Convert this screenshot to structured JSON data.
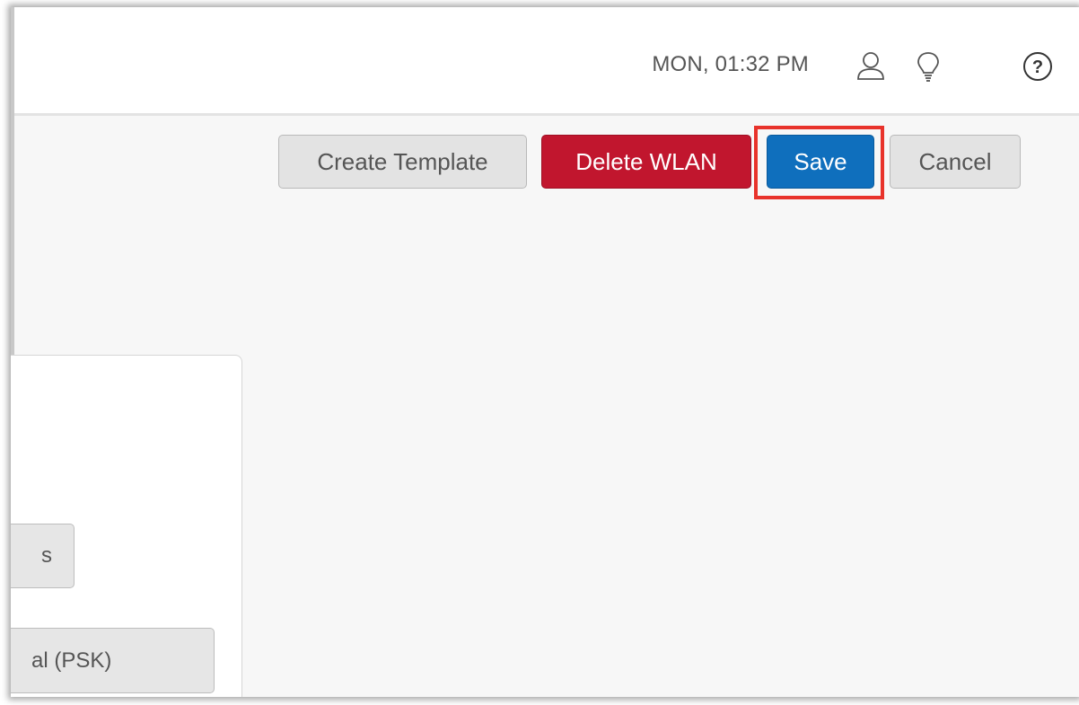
{
  "header": {
    "clock": "MON, 01:32 PM",
    "icons": [
      "user-icon",
      "lightbulb-icon",
      "help-icon"
    ]
  },
  "toolbar": {
    "create_template_label": "Create Template",
    "delete_wlan_label": "Delete WLAN",
    "save_label": "Save",
    "cancel_label": "Cancel"
  },
  "panel": {
    "button_1_label": "s",
    "button_2_label": "al (PSK)"
  },
  "colors": {
    "delete": "#c1162e",
    "save": "#0f6fbd",
    "highlight": "#e8332b"
  }
}
